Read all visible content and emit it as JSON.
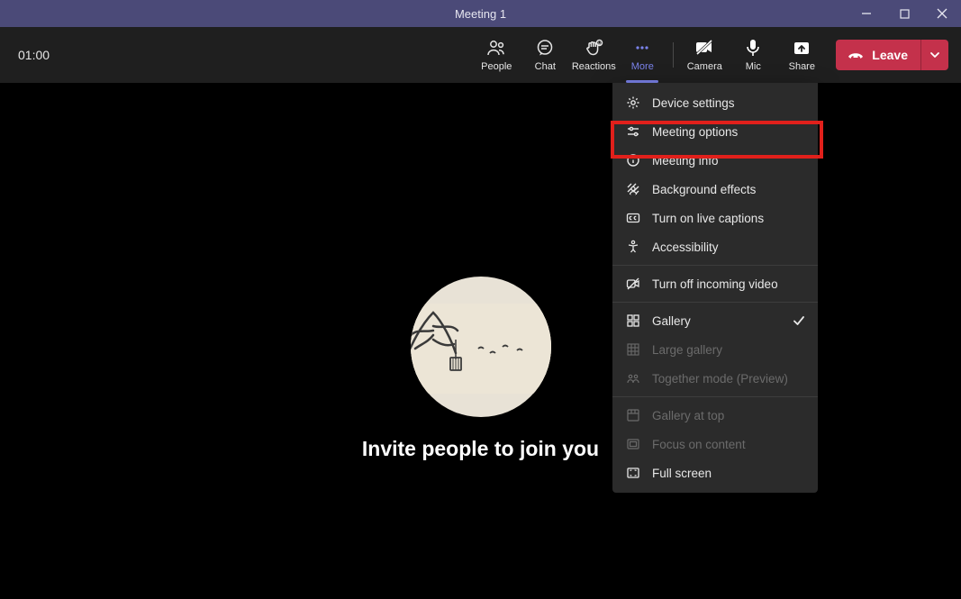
{
  "window": {
    "title": "Meeting 1"
  },
  "toolbar": {
    "timer": "01:00",
    "people": "People",
    "chat": "Chat",
    "reactions": "Reactions",
    "more": "More",
    "camera": "Camera",
    "mic": "Mic",
    "share": "Share",
    "leave": "Leave"
  },
  "stage": {
    "invite_text": "Invite people to join you"
  },
  "more_menu": {
    "device_settings": "Device settings",
    "meeting_options": "Meeting options",
    "meeting_info": "Meeting info",
    "background_effects": "Background effects",
    "live_captions": "Turn on live captions",
    "accessibility": "Accessibility",
    "turn_off_incoming": "Turn off incoming video",
    "gallery": "Gallery",
    "large_gallery": "Large gallery",
    "together_mode": "Together mode (Preview)",
    "gallery_at_top": "Gallery at top",
    "focus_on_content": "Focus on content",
    "full_screen": "Full screen"
  }
}
